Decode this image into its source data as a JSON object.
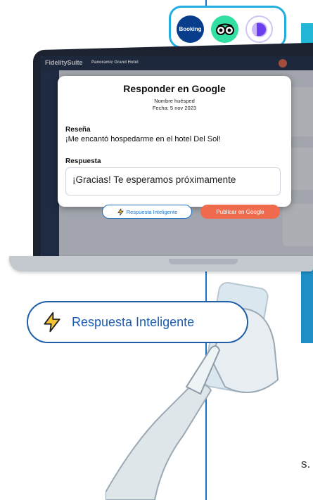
{
  "colors": {
    "accent_blue": "#1c5db4",
    "teal": "#22b7d6",
    "publish_orange": "#f06a4e",
    "dark_navy": "#24324a"
  },
  "brands": {
    "booking_label": "Booking",
    "icons": [
      "booking-icon",
      "tripadvisor-icon",
      "brand-d-icon"
    ]
  },
  "app": {
    "logo": "FidelitySuite",
    "hotel": "Panoramic Grand Hotel"
  },
  "modal": {
    "title": "Responder en Google",
    "guest_name": "Nombre huésped",
    "date": "Fecha: 5 nov 2023",
    "review_label": "Reseña",
    "review_text": "¡Me encantó hospedarme en el hotel Del Sol!",
    "response_label": "Respuesta",
    "response_value": "¡Gracias! Te esperamos próximamente",
    "smart_button": "Respuesta Inteligente",
    "publish_button": "Publicar en Google"
  },
  "feature_pill": {
    "label": "Respuesta Inteligente",
    "icon": "lightning-icon"
  },
  "edge_text": "s."
}
